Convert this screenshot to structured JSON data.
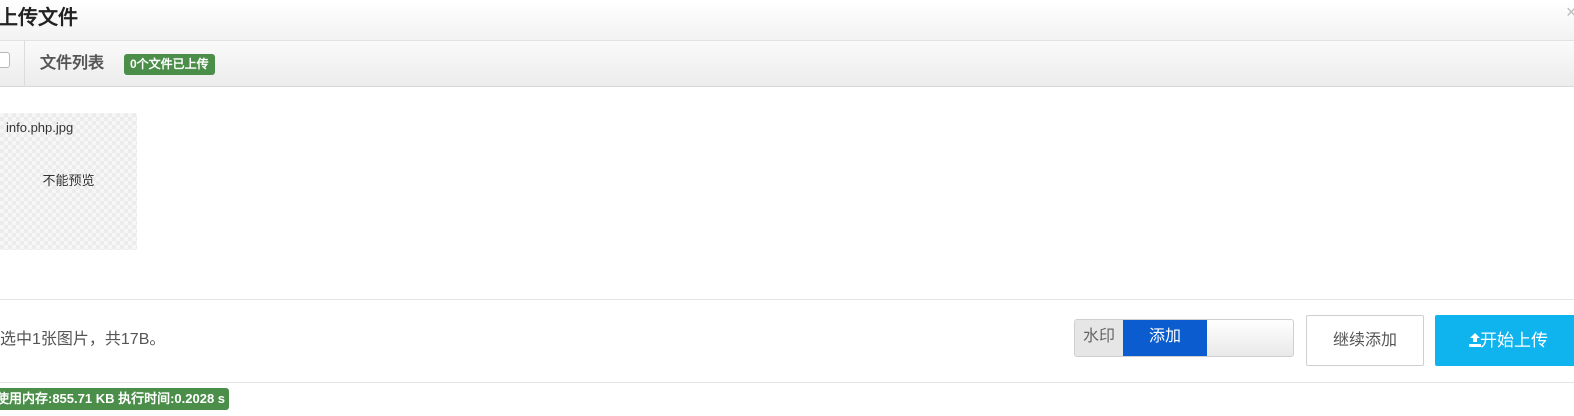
{
  "dialog": {
    "title": "上传文件",
    "close_icon": "close-icon"
  },
  "toolbar": {
    "list_label": "文件列表",
    "upload_badge": "0个文件已上传"
  },
  "files": [
    {
      "name": "info.php.jpg",
      "preview_text": "不能预览"
    }
  ],
  "footer": {
    "selection_info": "选中1张图片，共17B。",
    "watermark_label": "水印",
    "watermark_on_label": "添加",
    "continue_label": "继续添加",
    "start_upload_label": "开始上传",
    "start_upload_icon": "upload-icon"
  },
  "debug": {
    "stats": "使用内存:855.71 KB 执行时间:0.2028 s"
  },
  "colors": {
    "badge_green": "#4b8e4a",
    "toggle_blue": "#0a5ccf",
    "primary_button": "#0fb4ef"
  }
}
